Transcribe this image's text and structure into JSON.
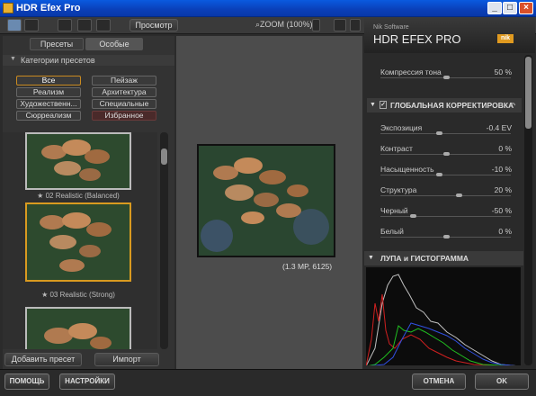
{
  "window": {
    "title": "HDR Efex Pro",
    "minimize": "_",
    "maximize": "□",
    "close": "×"
  },
  "toolbar": {
    "preview_label": "Просмотр",
    "zoom_label": "ZOOM (100%)"
  },
  "left_panel": {
    "tabs": [
      {
        "label": "Пресеты",
        "active": false
      },
      {
        "label": "Особые",
        "active": true
      }
    ],
    "categories_title": "Категории пресетов",
    "categories": [
      "Все",
      "Пейзаж",
      "Реализм",
      "Архитектура",
      "Художественн...",
      "Специальные",
      "Сюрреализм",
      "Избранное"
    ],
    "selected_category": "Все",
    "presets": [
      {
        "label": "★ 02 Realistic (Balanced)",
        "selected": false
      },
      {
        "label": "★ 03 Realistic (Strong)",
        "selected": true
      },
      {
        "label": "",
        "selected": false
      }
    ],
    "add_preset_label": "Добавить пресет",
    "import_label": "Импорт"
  },
  "center": {
    "image_info": "(1.3 MP, 6125)"
  },
  "right_panel": {
    "brand_small": "Nik Software",
    "brand_title": "HDR EFEX PRO",
    "brand_logo": "nik",
    "tone_compression": {
      "label": "Компрессия тона",
      "value": "50",
      "unit": "%",
      "level": 0.5
    },
    "global_section": "ГЛОБАЛЬНАЯ КОРРЕКТИРОВКА",
    "sliders": [
      {
        "label": "Экспозиция",
        "value": "-0.4",
        "unit": "EV",
        "level": 0.45
      },
      {
        "label": "Контраст",
        "value": "0",
        "unit": "%",
        "level": 0.5
      },
      {
        "label": "Насыщенность",
        "value": "-10",
        "unit": "%",
        "level": 0.45
      },
      {
        "label": "Структура",
        "value": "20",
        "unit": "%",
        "level": 0.6
      },
      {
        "label": "Черный",
        "value": "-50",
        "unit": "%",
        "level": 0.25
      },
      {
        "label": "Белый",
        "value": "0",
        "unit": "%",
        "level": 0.5
      }
    ],
    "loupe_section": "ЛУПА и ГИСТОГРАММА"
  },
  "bottom": {
    "help": "ПОМОЩЬ",
    "settings": "НАСТРОЙКИ",
    "cancel": "ОТМЕНА",
    "ok": "OK"
  }
}
